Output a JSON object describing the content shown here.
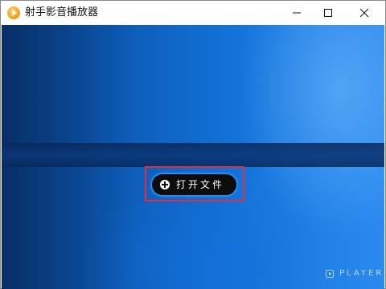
{
  "window": {
    "title": "射手影音播放器",
    "icon": "shooter-player-logo-icon"
  },
  "controls": {
    "minimize_icon": "minimize-icon",
    "maximize_icon": "maximize-icon",
    "close_icon": "close-icon"
  },
  "main": {
    "open_file_label": "打开文件",
    "open_file_icon": "plus-circle-icon",
    "brand_text": "PLAYER"
  },
  "colors": {
    "accent_blue": "#1e88f0",
    "button_bg": "#0d0d0d",
    "highlight_red": "#e0303a"
  }
}
